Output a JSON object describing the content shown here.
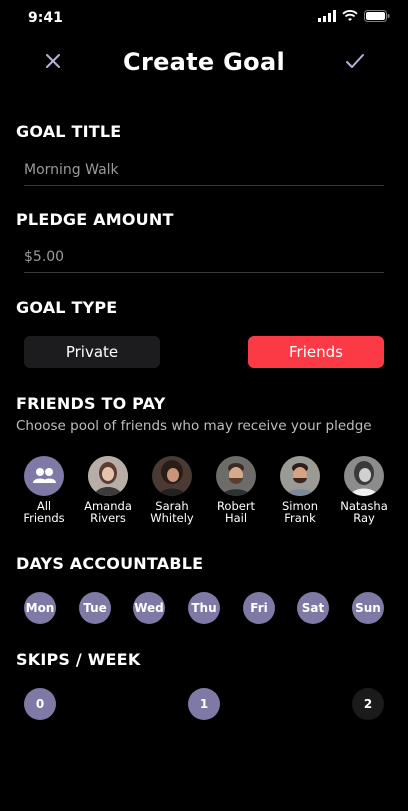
{
  "status": {
    "time": "9:41"
  },
  "header": {
    "title": "Create Goal"
  },
  "goal_title": {
    "label": "GOAL TITLE",
    "value": "Morning Walk"
  },
  "pledge": {
    "label": "PLEDGE AMOUNT",
    "value": "$5.00"
  },
  "goal_type": {
    "label": "GOAL TYPE",
    "private_label": "Private",
    "friends_label": "Friends",
    "selected": "Friends"
  },
  "friends": {
    "label": "FRIENDS TO PAY",
    "subtitle": "Choose pool of friends who may receive your pledge",
    "items": [
      {
        "line1": "All",
        "line2": "Friends"
      },
      {
        "line1": "Amanda",
        "line2": "Rivers"
      },
      {
        "line1": "Sarah",
        "line2": "Whitely"
      },
      {
        "line1": "Robert",
        "line2": "Hail"
      },
      {
        "line1": "Simon",
        "line2": "Frank"
      },
      {
        "line1": "Natasha",
        "line2": "Ray"
      }
    ]
  },
  "days": {
    "label": "DAYS ACCOUNTABLE",
    "items": [
      "Mon",
      "Tue",
      "Wed",
      "Thu",
      "Fri",
      "Sat",
      "Sun"
    ]
  },
  "skips": {
    "label": "SKIPS / WEEK",
    "items": [
      "0",
      "1",
      "2"
    ],
    "selected": [
      "0",
      "1"
    ]
  },
  "colors": {
    "accent": "#fc3a45",
    "chip": "#7f7aa5",
    "dark_button": "#1c1c1e"
  }
}
